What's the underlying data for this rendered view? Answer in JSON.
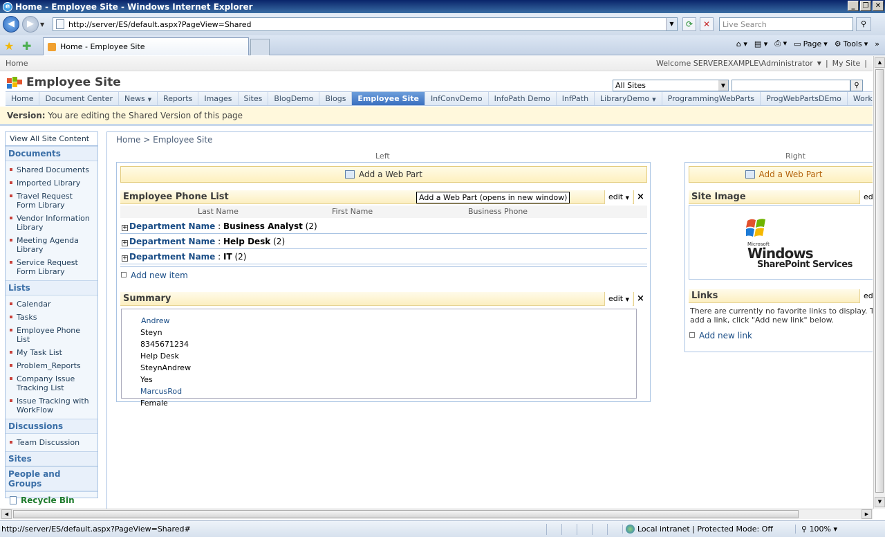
{
  "window": {
    "title": "Home - Employee Site - Windows Internet Explorer",
    "minimize": "_",
    "restore": "❐",
    "close": "✕"
  },
  "address": {
    "url": "http://server/ES/default.aspx?PageView=Shared",
    "search_placeholder": "Live Search"
  },
  "tabs": {
    "active_label": "Home - Employee Site"
  },
  "commandbar": {
    "page": "Page",
    "tools": "Tools"
  },
  "global": {
    "home": "Home",
    "welcome": "Welcome SERVEREXAMPLE\\Administrator",
    "my_site": "My Site",
    "separator": "|"
  },
  "site": {
    "title": "Employee Site",
    "scope": "All Sites"
  },
  "topnav": [
    {
      "label": "Home",
      "dropdown": false
    },
    {
      "label": "Document Center",
      "dropdown": false
    },
    {
      "label": "News",
      "dropdown": true
    },
    {
      "label": "Reports",
      "dropdown": false
    },
    {
      "label": "Images",
      "dropdown": false
    },
    {
      "label": "Sites",
      "dropdown": false
    },
    {
      "label": "BlogDemo",
      "dropdown": false
    },
    {
      "label": "Blogs",
      "dropdown": false
    },
    {
      "label": "Employee Site",
      "dropdown": false,
      "selected": true
    },
    {
      "label": "InfConvDemo",
      "dropdown": false
    },
    {
      "label": "InfoPath Demo",
      "dropdown": false
    },
    {
      "label": "InfPath",
      "dropdown": false
    },
    {
      "label": "LibraryDemo",
      "dropdown": true
    },
    {
      "label": "ProgrammingWebParts",
      "dropdown": false
    },
    {
      "label": "ProgWebPartsDEmo",
      "dropdown": false
    },
    {
      "label": "Workflow Demo Site",
      "dropdown": false
    }
  ],
  "editbar": {
    "label": "Version:",
    "text": "You are editing the Shared Version of this page"
  },
  "leftnav": {
    "view_all": "View All Site Content",
    "documents_header": "Documents",
    "documents": [
      "Shared Documents",
      "Imported Library",
      "Travel Request Form Library",
      "Vendor Information Library",
      "Meeting Agenda Library",
      "Service Request Form Library"
    ],
    "lists_header": "Lists",
    "lists": [
      "Calendar",
      "Tasks",
      "Employee Phone List",
      "My Task List",
      "Problem_Reports",
      "Company Issue Tracking List",
      "Issue Tracking with WorkFlow"
    ],
    "discussions_header": "Discussions",
    "discussions": [
      "Team Discussion"
    ],
    "sites_header": "Sites",
    "people_header": "People and Groups",
    "recycle_bin": "Recycle Bin"
  },
  "main": {
    "breadcrumb": "Home > Employee Site",
    "left_zone_label": "Left",
    "right_zone_label": "Right",
    "add_web_part": "Add a Web Part",
    "tooltip": "Add a Web Part (opens in new window)",
    "edit": "edit",
    "close": "×",
    "phone_list": {
      "title": "Employee Phone List",
      "columns": [
        "Last Name",
        "First Name",
        "Business Phone"
      ],
      "groups": [
        {
          "field": "Department Name",
          "value": "Business Analyst",
          "count": "(2)"
        },
        {
          "field": "Department Name",
          "value": "Help Desk",
          "count": "(2)"
        },
        {
          "field": "Department Name",
          "value": "IT",
          "count": "(2)"
        }
      ],
      "add_new": "Add new item"
    },
    "summary": {
      "title": "Summary",
      "values": [
        "Andrew",
        "Steyn",
        "8345671234",
        "Help Desk",
        "SteynAndrew",
        "Yes",
        "MarcusRod",
        "Female"
      ]
    },
    "site_image": {
      "title": "Site Image",
      "logo_small": "Microsoft",
      "logo_main": "Windows",
      "logo_sub": "SharePoint Services",
      "edit_cut": "ed"
    },
    "links": {
      "title": "Links",
      "message": "There are currently no favorite links to display. To add a link, click \"Add new link\" below.",
      "add_new": "Add new link"
    }
  },
  "status": {
    "url": "http://server/ES/default.aspx?PageView=Shared#",
    "zone": "Local intranet | Protected Mode: Off",
    "zoom": "100%"
  }
}
